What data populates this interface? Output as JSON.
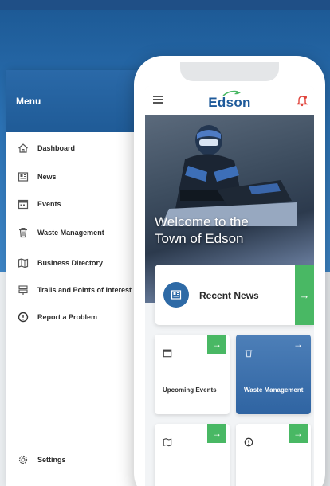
{
  "drawer": {
    "title": "Menu",
    "items": [
      {
        "label": "Dashboard",
        "icon": "home-icon"
      },
      {
        "label": "News",
        "icon": "newspaper-icon"
      },
      {
        "label": "Events",
        "icon": "calendar-icon"
      },
      {
        "label": "Waste Management",
        "icon": "trash-icon"
      },
      {
        "label": "Business Directory",
        "icon": "map-icon"
      },
      {
        "label": "Trails and Points of Interest",
        "icon": "signpost-icon"
      },
      {
        "label": "Report a Problem",
        "icon": "alert-circle-icon"
      }
    ],
    "footer": {
      "label": "Settings",
      "icon": "gear-icon"
    }
  },
  "app": {
    "logo_text": "Edson",
    "hero_line1": "Welcome to the",
    "hero_line2": "Town of Edson",
    "news_label": "Recent News",
    "arrow": "→",
    "tiles": [
      {
        "label": "Upcoming Events",
        "icon": "calendar-icon"
      },
      {
        "label": "Waste Management",
        "icon": "trash-icon"
      },
      {
        "label": "",
        "icon": "map-icon"
      },
      {
        "label": "",
        "icon": "alert-circle-icon"
      }
    ]
  },
  "colors": {
    "brand_blue": "#1e5a9a",
    "accent_green": "#49b864",
    "alert_red": "#e0443c"
  }
}
